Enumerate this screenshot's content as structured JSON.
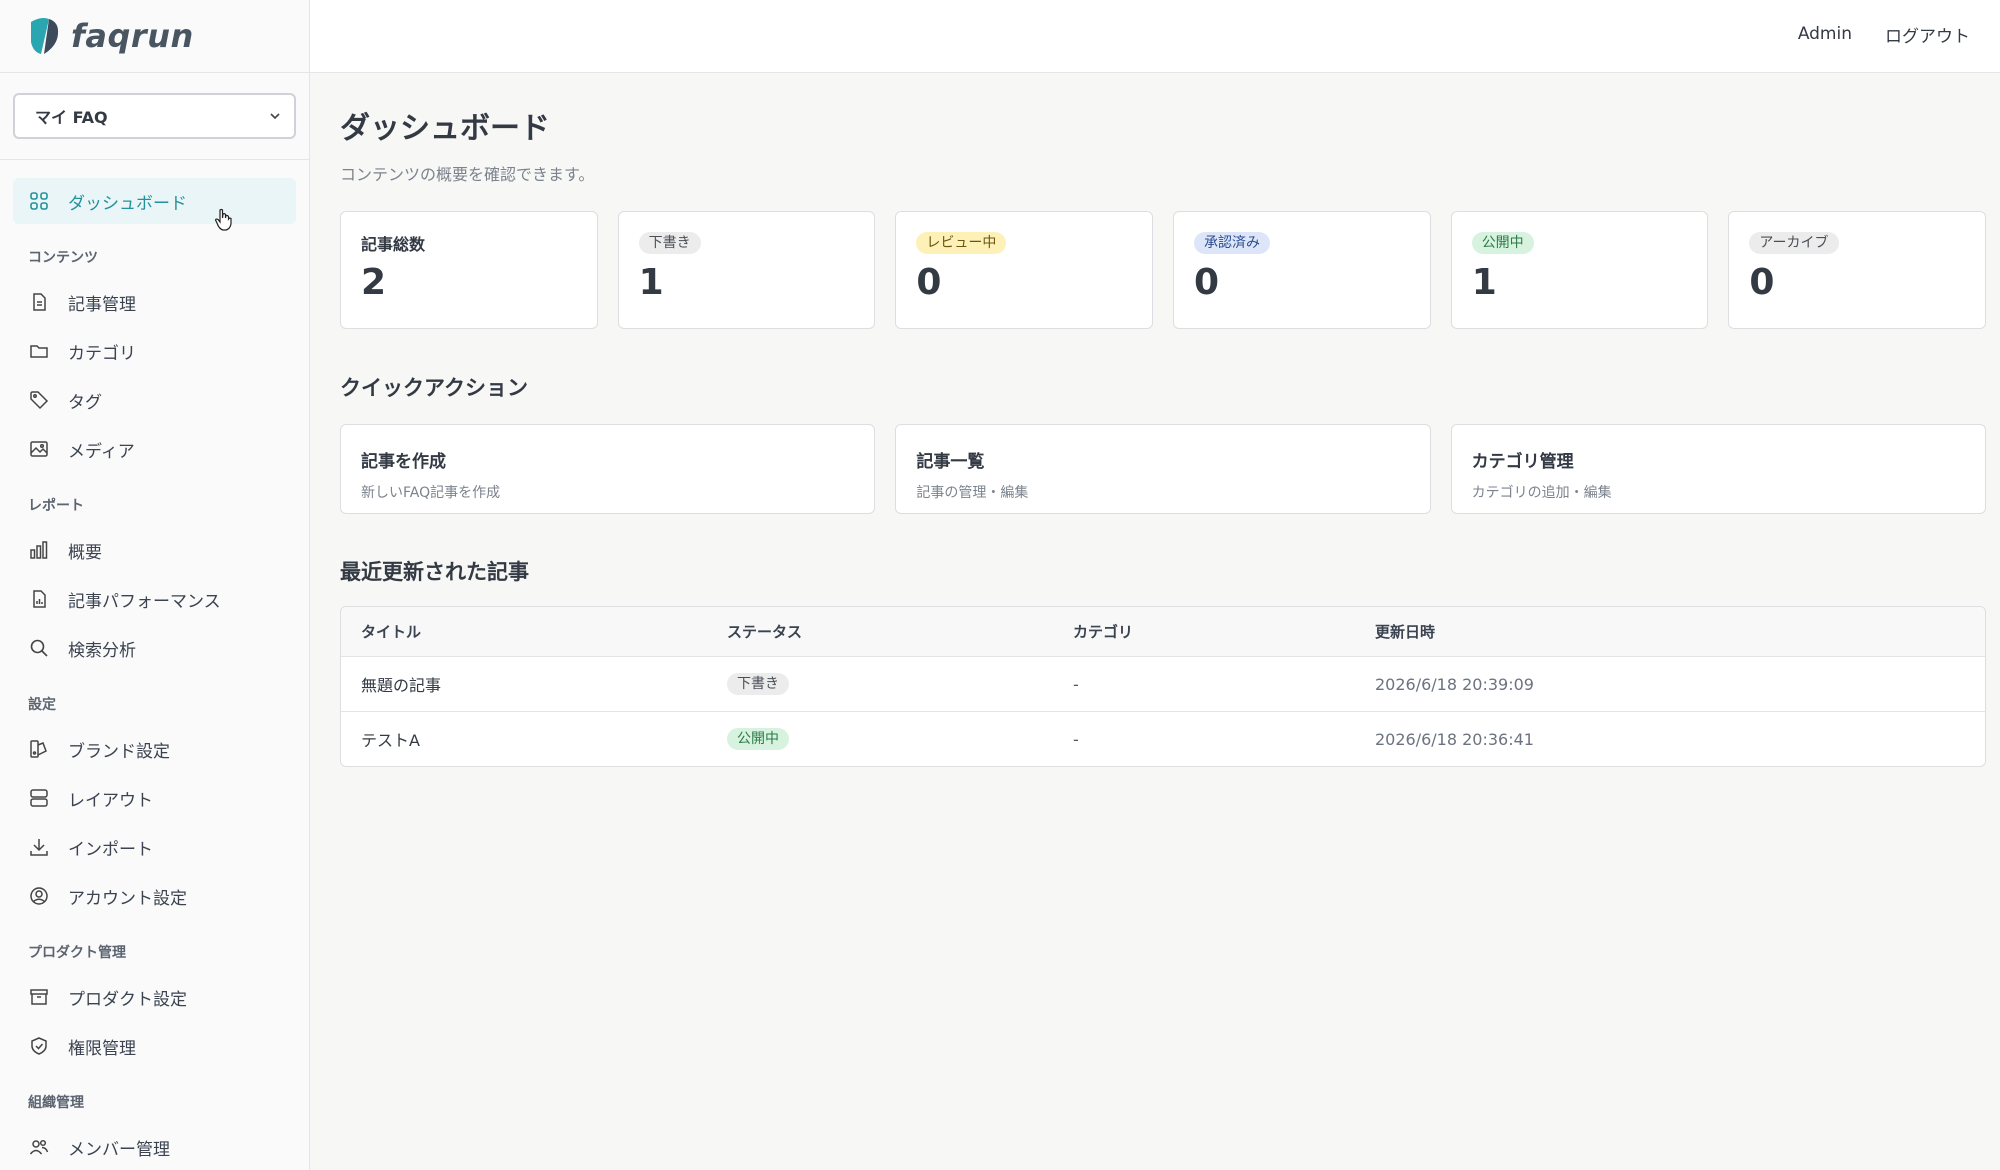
{
  "app": {
    "logo_text": "faqrun"
  },
  "header": {
    "user": "Admin",
    "logout": "ログアウト"
  },
  "sidebar": {
    "project_select": "マイ FAQ",
    "dashboard": "ダッシュボード",
    "sections": [
      {
        "title": "コンテンツ",
        "items": [
          "記事管理",
          "カテゴリ",
          "タグ",
          "メディア"
        ]
      },
      {
        "title": "レポート",
        "items": [
          "概要",
          "記事パフォーマンス",
          "検索分析"
        ]
      },
      {
        "title": "設定",
        "items": [
          "ブランド設定",
          "レイアウト",
          "インポート",
          "アカウント設定"
        ]
      },
      {
        "title": "プロダクト管理",
        "items": [
          "プロダクト設定",
          "権限管理"
        ]
      },
      {
        "title": "組織管理",
        "items": [
          "メンバー管理"
        ]
      }
    ]
  },
  "page": {
    "title": "ダッシュボード",
    "subtitle": "コンテンツの概要を確認できます。"
  },
  "stats": [
    {
      "label": "記事総数",
      "value": "2"
    },
    {
      "label": "下書き",
      "value": "1"
    },
    {
      "label": "レビュー中",
      "value": "0"
    },
    {
      "label": "承認済み",
      "value": "0"
    },
    {
      "label": "公開中",
      "value": "1"
    },
    {
      "label": "アーカイブ",
      "value": "0"
    }
  ],
  "quick_actions": {
    "title": "クイックアクション",
    "items": [
      {
        "title": "記事を作成",
        "sub": "新しいFAQ記事を作成"
      },
      {
        "title": "記事一覧",
        "sub": "記事の管理・編集"
      },
      {
        "title": "カテゴリ管理",
        "sub": "カテゴリの追加・編集"
      }
    ]
  },
  "recent": {
    "title": "最近更新された記事",
    "columns": [
      "タイトル",
      "ステータス",
      "カテゴリ",
      "更新日時"
    ],
    "rows": [
      {
        "title": "無題の記事",
        "status": "下書き",
        "category": "-",
        "updated": "2026/6/18 20:39:09"
      },
      {
        "title": "テストA",
        "status": "公開中",
        "category": "-",
        "updated": "2026/6/18 20:36:41"
      }
    ]
  },
  "colors": {
    "accent": "#24929d",
    "logo_teal": "#2aa6b0",
    "logo_dark": "#3c4a5c"
  }
}
